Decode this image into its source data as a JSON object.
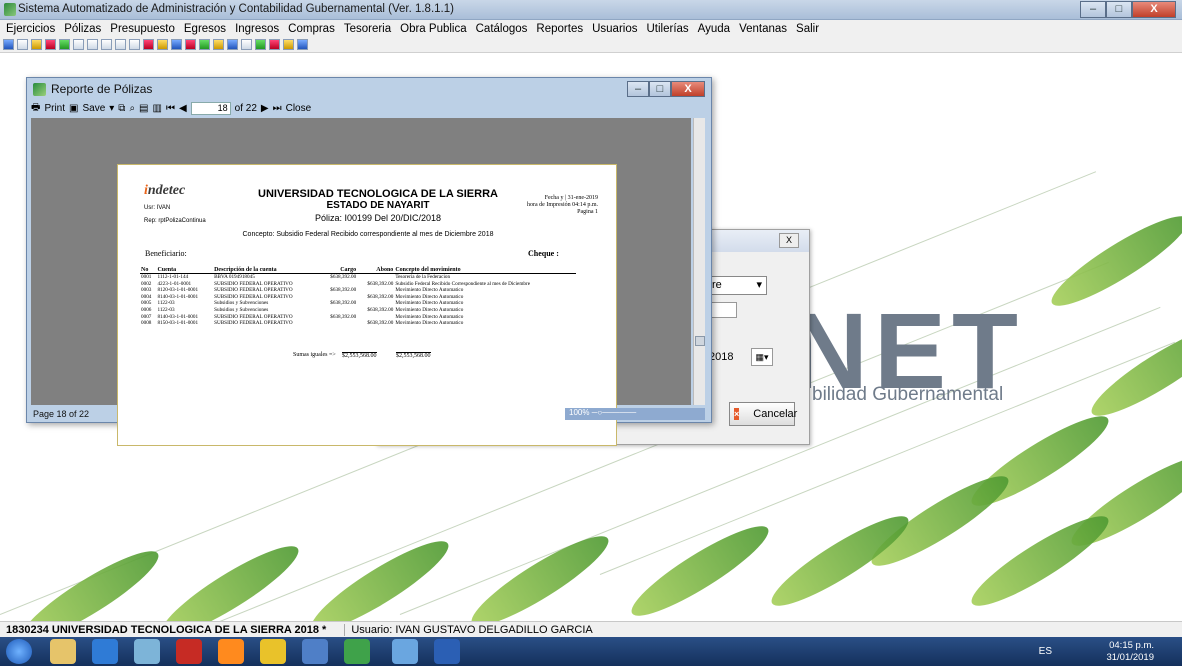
{
  "window": {
    "title": "Sistema Automatizado de Administración y Contabilidad Gubernamental  (Ver. 1.8.1.1)",
    "min": "–",
    "max": "□",
    "close": "X"
  },
  "menu": [
    "Ejercicios",
    "Pólizas",
    "Presupuesto",
    "Egresos",
    "Ingresos",
    "Compras",
    "Tesoreria",
    "Obra Publica",
    "Catálogos",
    "Reportes",
    "Usuarios",
    "Utilerías",
    "Ayuda",
    "Ventanas",
    "Salir"
  ],
  "background": {
    "brand": "NET",
    "subtitle": "bilidad Gubernamental"
  },
  "dialog2": {
    "combo_value": "re",
    "date": "2018",
    "cancel": "Cancelar",
    "close": "X"
  },
  "report": {
    "title": "Reporte de Pólizas",
    "toolbar": {
      "print": "Print",
      "save": "Save",
      "page_value": "18",
      "page_of": "of 22",
      "close": "Close"
    },
    "status": "Page 18 of 22",
    "zoom": "100%",
    "doc": {
      "logo": "ndetec",
      "user": "Usr: IVAN",
      "rep": "Rep: rptPolizaContinua",
      "university": "UNIVERSIDAD TECNOLOGICA DE LA SIERRA",
      "state": "ESTADO DE NAYARIT",
      "poliza": "Póliza: I00199 Del 20/DIC/2018",
      "fecha_label": "Fecha y",
      "fecha": "31-ene-2019",
      "hora_label": "hora de Impresión",
      "hora": "04:14 p.m.",
      "pagina_label": "Pagina",
      "pagina": "1",
      "concepto": "Concepto: Subsidio Federal Recibido correspondiente al mes de Diciembre  2018",
      "beneficiario": "Beneficiario:",
      "cheque": "Cheque :",
      "headers": [
        "No",
        "Cuenta",
        "Descripción de la cuenta",
        "Cargo",
        "Abono",
        "Concepto del movimiento"
      ],
      "rows": [
        [
          "0001",
          "1112-1-01-144",
          "BBVA 0194918045",
          "$638,392.00",
          "",
          "Tesoreria de la Federacion"
        ],
        [
          "0002",
          "4223-1-01-0001",
          "SUBSIDIO FEDERAL OPERATIVO",
          "",
          "$638,392.00",
          "Subsidio Federal Recibido Correspondiente al mes de Diciembre"
        ],
        [
          "0003",
          "8120-03-1-01-0001",
          "SUBSIDIO FEDERAL OPERATIVO",
          "$638,392.00",
          "",
          "Movimiento Directo Automatico"
        ],
        [
          "0004",
          "8140-03-1-01-0001",
          "SUBSIDIO FEDERAL OPERATIVO",
          "",
          "$638,392.00",
          "Movimiento Directo Automatico"
        ],
        [
          "0005",
          "1122-03",
          "Subsidios y Subvenciones",
          "$638,392.00",
          "",
          "Movimiento Directo Automatico"
        ],
        [
          "0006",
          "1122-03",
          "Subsidios y Subvenciones",
          "",
          "$638,392.00",
          "Movimiento Directo Automatico"
        ],
        [
          "0007",
          "8140-03-1-01-0001",
          "SUBSIDIO FEDERAL OPERATIVO",
          "$638,392.00",
          "",
          "Movimiento Directo Automatico"
        ],
        [
          "0008",
          "8150-03-1-01-0001",
          "SUBSIDIO FEDERAL OPERATIVO",
          "",
          "$638,392.00",
          "Movimiento Directo Automatico"
        ]
      ],
      "sumas_label": "Sumas iguales =>",
      "sum_cargo": "$2,553,568.00",
      "sum_abono": "$2,553,568.00"
    }
  },
  "statusbar": {
    "left": "1830234 UNIVERSIDAD TECNOLOGICA DE LA SIERRA  2018  *",
    "user": "Usuario: IVAN GUSTAVO DELGADILLO GARCIA"
  },
  "taskbar": {
    "lang": "ES",
    "time": "04:15 p.m.",
    "date": "31/01/2019"
  }
}
